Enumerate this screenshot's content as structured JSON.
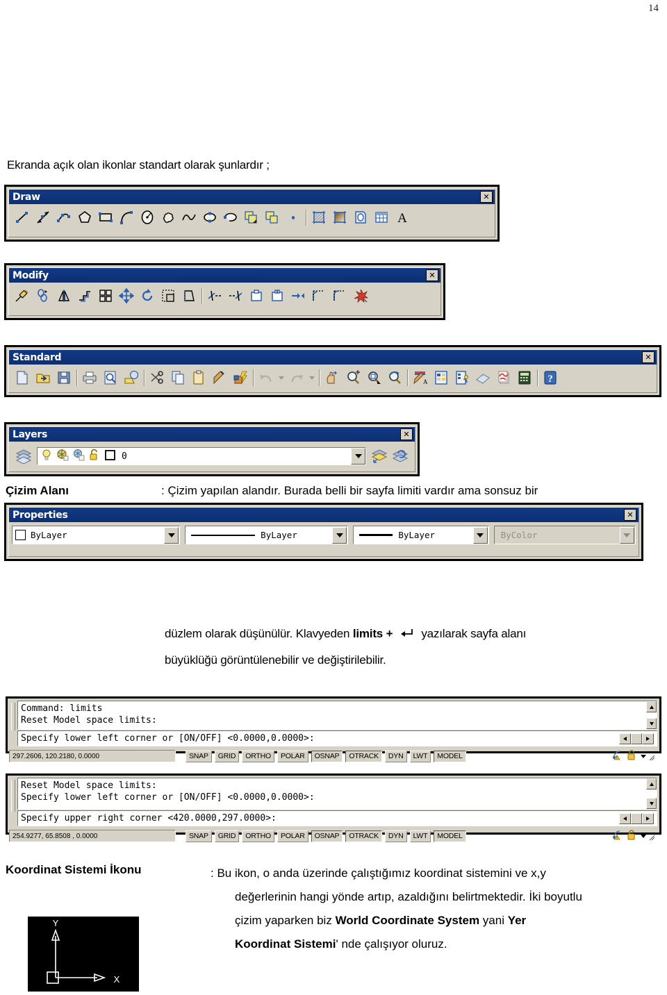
{
  "page": {
    "number": "14"
  },
  "intro_text": "Ekranda açık olan ikonlar standart olarak şunlardır ;",
  "toolbars": {
    "draw": {
      "title": "Draw",
      "close_label": "✕",
      "icons": [
        "line-icon",
        "construction-line-icon",
        "polyline-icon",
        "polygon-icon",
        "rectangle-icon",
        "arc-icon",
        "circle-icon",
        "revision-cloud-icon",
        "spline-icon",
        "ellipse-icon",
        "ellipse-arc-icon",
        "insert-block-icon",
        "make-block-icon",
        "point-icon",
        "hatch-icon",
        "gradient-icon",
        "region-icon",
        "table-icon",
        "multiline-text-icon"
      ]
    },
    "modify": {
      "title": "Modify",
      "close_label": "✕",
      "icons": [
        "erase-icon",
        "copy-icon",
        "mirror-icon",
        "offset-icon",
        "array-icon",
        "move-icon",
        "rotate-icon",
        "scale-icon",
        "stretch-icon",
        "trim-icon",
        "extend-icon",
        "break-icon",
        "break-at-point-icon",
        "join-icon",
        "chamfer-icon",
        "fillet-icon",
        "explode-icon"
      ]
    },
    "standard": {
      "title": "Standard",
      "close_label": "✕",
      "icons": [
        "new-icon",
        "open-icon",
        "save-icon",
        "plot-icon",
        "plot-preview-icon",
        "publish-icon",
        "cut-icon",
        "copy-clip-icon",
        "paste-clip-icon",
        "match-properties-icon",
        "block-editor-icon",
        "undo-icon",
        "undo-dropdown-icon",
        "redo-icon",
        "redo-dropdown-icon",
        "pan-realtime-icon",
        "zoom-realtime-icon",
        "zoom-window-icon",
        "zoom-previous-icon",
        "properties-icon",
        "designcenter-icon",
        "tool-palettes-icon",
        "sheet-set-manager-icon",
        "markup-set-manager-icon",
        "quickcalc-icon",
        "help-icon"
      ]
    },
    "layers": {
      "title": "Layers",
      "close_label": "✕",
      "layer_name": "0",
      "icons": [
        "layer-properties-manager-icon",
        "layer-on-off-icon",
        "layer-freeze-thaw-icon",
        "layer-freeze-current-viewport-icon",
        "layer-lock-unlock-icon",
        "layer-color-swatch-icon",
        "layer-dropdown-arrow-icon",
        "make-object-layer-current-icon",
        "layer-previous-icon"
      ]
    },
    "properties": {
      "title": "Properties",
      "close_label": "✕",
      "combos": [
        {
          "name": "color-control",
          "value": "ByLayer",
          "kind": "swatch",
          "disabled": false
        },
        {
          "name": "linetype-control",
          "value": "ByLayer",
          "kind": "linetype",
          "disabled": false
        },
        {
          "name": "lineweight-control",
          "value": "ByLayer",
          "kind": "lineweight",
          "disabled": false
        },
        {
          "name": "plot-style-control",
          "value": "ByColor",
          "kind": "plain",
          "disabled": true
        }
      ]
    }
  },
  "occluded_line": {
    "term": "Çizim Alanı",
    "definition": ": Çizim yapılan alandır. Burada belli bir sayfa limiti vardır ama sonsuz bir"
  },
  "paragraph_limits": {
    "line1_a": "düzlem olarak düşünülür. Klavyeden ",
    "line1_bold": "limits",
    "line1_plus": "+",
    "line1_enter_icon": "enter-key-icon",
    "line1_b": "yazılarak sayfa alanı",
    "line2": "büyüklüğü görüntülenebilir ve değiştirilebilir."
  },
  "command_windows": [
    {
      "name": "command-window-1",
      "history": "Command: limits\nReset Model space limits:",
      "prompt": "Specify lower left corner or [ON/OFF] <0.0000,0.0000>:",
      "coords": "297.2606, 120.2180, 0.0000",
      "toggles": [
        {
          "label": "SNAP",
          "active": false
        },
        {
          "label": "GRID",
          "active": false
        },
        {
          "label": "ORTHO",
          "active": false
        },
        {
          "label": "POLAR",
          "active": false
        },
        {
          "label": "OSNAP",
          "active": true
        },
        {
          "label": "OTRACK",
          "active": true
        },
        {
          "label": "DYN",
          "active": false
        },
        {
          "label": "LWT",
          "active": false
        },
        {
          "label": "MODEL",
          "active": true
        }
      ]
    },
    {
      "name": "command-window-2",
      "history": "Reset Model space limits:\nSpecify lower left corner or [ON/OFF] <0.0000,0.0000>:",
      "prompt": "Specify upper right corner <420.0000,297.0000>:",
      "coords": "254.9277, 65.8508 , 0.0000",
      "toggles": [
        {
          "label": "SNAP",
          "active": false
        },
        {
          "label": "GRID",
          "active": false
        },
        {
          "label": "ORTHO",
          "active": false
        },
        {
          "label": "POLAR",
          "active": false
        },
        {
          "label": "OSNAP",
          "active": true
        },
        {
          "label": "OTRACK",
          "active": true
        },
        {
          "label": "DYN",
          "active": false
        },
        {
          "label": "LWT",
          "active": false
        },
        {
          "label": "MODEL",
          "active": true
        }
      ]
    }
  ],
  "ucs_section": {
    "term": "Koordinat Sistemi İkonu",
    "line1": ": Bu ikon, o anda üzerinde çalıştığımız koordinat sistemini ve x,y",
    "line2": "değerlerinin  hangi yönde artıp, azaldığını belirtmektedir. İki boyutlu",
    "line3_a": "çizim yaparken biz ",
    "line3_bold": "World Coordinate System",
    "line3_b": " yani ",
    "line3_bold2": "Yer",
    "line4_bold": "Koordinat Sistemi",
    "line4_b": "' nde çalışıyor oluruz.",
    "icon_x_label": "X",
    "icon_y_label": "Y"
  },
  "colors": {
    "titlebar_blue": "#123a86",
    "toolbar_face": "#d6d2c6",
    "window_black": "#000000",
    "field_white": "#ffffff",
    "disabled_gray": "#918d84"
  }
}
